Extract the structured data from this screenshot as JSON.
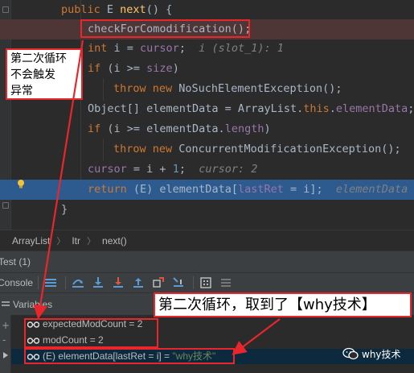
{
  "editor": {
    "lines": [
      {
        "role": "signature",
        "parts": [
          [
            "kw",
            "public "
          ],
          [
            "pln",
            "E "
          ],
          [
            "mth",
            "next"
          ],
          [
            "pln",
            "() {"
          ]
        ]
      },
      {
        "role": "check-call",
        "parts": [
          [
            "pln",
            "checkForComodification();"
          ]
        ]
      },
      {
        "role": "cursor-assign",
        "parts": [
          [
            "kw",
            "int "
          ],
          [
            "pln",
            "i = "
          ],
          [
            "fld",
            "cursor"
          ],
          [
            "pln",
            ";  "
          ],
          [
            "ival",
            "i (slot_1): 1"
          ]
        ]
      },
      {
        "role": "if-size",
        "parts": [
          [
            "kw",
            "if "
          ],
          [
            "pln",
            "(i >= "
          ],
          [
            "fld",
            "size"
          ],
          [
            "pln",
            ")"
          ]
        ]
      },
      {
        "role": "throw-nosuch",
        "parts": [
          [
            "kw",
            "throw new "
          ],
          [
            "pln",
            "NoSuchElementException();"
          ]
        ]
      },
      {
        "role": "elementdata-assign",
        "parts": [
          [
            "pln",
            "Object[] elementData = ArrayList."
          ],
          [
            "kw",
            "this"
          ],
          [
            "pln",
            "."
          ],
          [
            "fld",
            "elementData"
          ],
          [
            "pln",
            ";"
          ]
        ]
      },
      {
        "role": "if-length",
        "parts": [
          [
            "kw",
            "if "
          ],
          [
            "pln",
            "(i >= elementData."
          ],
          [
            "fld",
            "length"
          ],
          [
            "pln",
            ")"
          ]
        ]
      },
      {
        "role": "throw-concurrent",
        "parts": [
          [
            "kw",
            "throw new "
          ],
          [
            "pln",
            "ConcurrentModificationException();"
          ]
        ]
      },
      {
        "role": "cursor-increment",
        "parts": [
          [
            "fld",
            "cursor"
          ],
          [
            "pln",
            " = i + "
          ],
          [
            "num",
            "1"
          ],
          [
            "pln",
            ";  "
          ],
          [
            "ival",
            "cursor: 2"
          ]
        ]
      },
      {
        "role": "return-line",
        "parts": [
          [
            "kw",
            "return "
          ],
          [
            "pln",
            "(E) elementData["
          ],
          [
            "fld",
            "lastRet"
          ],
          [
            "pln",
            " = i];  "
          ],
          [
            "ival",
            "elementData ("
          ]
        ]
      },
      {
        "role": "closing-brace",
        "parts": [
          [
            "pln",
            "}"
          ]
        ]
      }
    ]
  },
  "breadcrumb": [
    "ArrayList",
    "Itr",
    "next()"
  ],
  "debug": {
    "test_tab": "Test (1)",
    "console_tab": "Console",
    "variables_label": "Variables"
  },
  "variables": [
    {
      "name": "expectedModCount",
      "text": "expectedModCount = 2"
    },
    {
      "name": "modCount",
      "text": "modCount = 2"
    },
    {
      "name": "element",
      "prefix": "(E) elementData[lastRet = i] = ",
      "value": "\"why技术\""
    }
  ],
  "annotations": {
    "left_callout": [
      "第二次循环",
      "不会触发",
      "异常"
    ],
    "bottom_callout": "第二次循环，取到了【why技术】"
  },
  "watermark": "why技术",
  "colors": {
    "annotation_red": "#e8262c",
    "error_line": "#4e3536",
    "current_line": "#2d5b8f",
    "keyword": "#cc7832",
    "field": "#9876aa",
    "string": "#6a8759"
  }
}
